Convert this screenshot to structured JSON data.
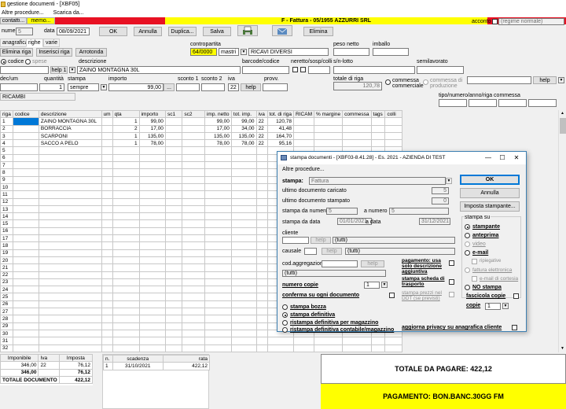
{
  "window": {
    "title": "gestione documenti - [XBF05]"
  },
  "menu": {
    "items": [
      "Altre procedure...",
      "Scarica da..."
    ]
  },
  "header": {
    "contatti_label": "contatti...",
    "memo_label": "memo...",
    "doc_title": "F - Fattura - 05/1955 AZZURRI SRL",
    "acconto_label": "acconto",
    "regime_placeholder": "(regime normale)",
    "numero_label": "numero",
    "numero_value": "5",
    "data_label": "data",
    "data_value": "08/09/2021",
    "ok_label": "OK",
    "annulla_label": "Annulla",
    "duplica_label": "Duplica...",
    "salva_label": "Salva",
    "elimina_label": "Elimina"
  },
  "tabs": [
    "anagrafica",
    "righe",
    "varie"
  ],
  "toolbar": {
    "elimina_riga": "Elimina riga",
    "inserisci_riga": "Inserisci riga",
    "arrotonda": "Arrotonda"
  },
  "row_form": {
    "contropartita_label": "contropartita",
    "contropartita_code": "64/0000",
    "contropartita_type": "mastri",
    "contropartita_desc": "RICAVI DIVERSI",
    "peso_netto_label": "peso netto",
    "imballo_label": "imballo",
    "codice_label": "codice",
    "spese_label": "spese",
    "descrizione_label": "descrizione",
    "barcode_label": "barcode/codice",
    "neretto_label": "neretto/sosp/colli",
    "sn_lotto_label": "s/n-lotto",
    "semilavorato_label": "semilavorato",
    "help1_label": "help 1",
    "descrizione_value": "ZAINO MONTAGNA 30L",
    "um_label": "dec/um",
    "quantita_label": "quantità",
    "quantita_value": "1",
    "stampa_label": "stampa",
    "stampa_value": "sempre",
    "importo_label": "importo",
    "importo_value": "99,00",
    "sconto1_label": "sconto 1",
    "sconto2_label": "sconto 2",
    "iva_label": "iva",
    "iva_value": "22",
    "help_label": "help",
    "provv_label": "provv.",
    "totale_riga_label": "totale di riga",
    "totale_riga_value": "120,78",
    "commessa_commerciale": "commessa commerciale",
    "commessa_produzione": "commessa di produzione",
    "tipo_label": "tipo/numero/anno/riga commessa",
    "ricambi_value": "RICAMBI"
  },
  "grid": {
    "columns": [
      "riga",
      "codice",
      "descrizione",
      "um",
      "qta",
      "importo",
      "sc1",
      "sc2",
      "imp. netto",
      "tot. imp.",
      "iva",
      "tot. di riga",
      "RICAM",
      "% margine",
      "commessa",
      "tags",
      "colli"
    ],
    "rows": [
      {
        "riga": "1",
        "descrizione": "ZAINO MONTAGNA 30L",
        "qta": "1",
        "importo": "99,00",
        "imp_netto": "99,00",
        "tot_imp": "99,00",
        "iva": "22",
        "tot_riga": "120,78"
      },
      {
        "riga": "2",
        "descrizione": "BORRACCIA",
        "qta": "2",
        "importo": "17,00",
        "imp_netto": "17,00",
        "tot_imp": "34,00",
        "iva": "22",
        "tot_riga": "41,48"
      },
      {
        "riga": "3",
        "descrizione": "SCARPONI",
        "qta": "1",
        "importo": "135,00",
        "imp_netto": "135,00",
        "tot_imp": "135,00",
        "iva": "22",
        "tot_riga": "164,70"
      },
      {
        "riga": "4",
        "descrizione": "SACCO A PELO",
        "qta": "1",
        "importo": "78,00",
        "imp_netto": "78,00",
        "tot_imp": "78,00",
        "iva": "22",
        "tot_riga": "95,16"
      }
    ],
    "empty_row_numbers": [
      "5",
      "6",
      "7",
      "8",
      "9",
      "10",
      "11",
      "12",
      "13",
      "14",
      "15",
      "16",
      "17",
      "18",
      "19",
      "20",
      "21",
      "22",
      "23",
      "24",
      "25",
      "26",
      "27",
      "28",
      "29",
      "30",
      "31",
      "32"
    ]
  },
  "iva_summary": {
    "columns": [
      "Imponibile",
      "Iva",
      "Imposta"
    ],
    "rows": [
      {
        "imponibile": "346,00",
        "iva": "22",
        "imposta": "76,12"
      }
    ],
    "totals": {
      "imponibile": "346,00",
      "imposta": "76,12"
    },
    "totale_documento_label": "TOTALE DOCUMENTO",
    "totale_documento_value": "422,12"
  },
  "scadenze": {
    "columns": [
      "n.",
      "scadenza",
      "rata"
    ],
    "rows": [
      {
        "n": "1",
        "scadenza": "31/10/2021",
        "rata": "422,12"
      }
    ]
  },
  "totals": {
    "totale_da_pagare": "TOTALE DA PAGARE: 422,12",
    "pagamento": "PAGAMENTO: BON.BANC.30GG FM"
  },
  "dialog": {
    "title": "stampa documenti - [XBF03-8.41.28] - Es. 2021 - AZIENDA DI TEST",
    "menu": "Altre procedure...",
    "stampa_label": "stampa:",
    "stampa_value": "Fattura",
    "ok_label": "OK",
    "annulla_label": "Annulla",
    "imposta_stampante_label": "Imposta stampante...",
    "ultimo_caricato_label": "ultimo documento caricato",
    "ultimo_caricato_value": "5",
    "ultimo_stampato_label": "ultimo documento stampato",
    "ultimo_stampato_value": "0",
    "stampa_da_numero_label": "stampa da numero",
    "stampa_da_numero_value": "5",
    "a_numero_label": "a numero",
    "a_numero_value": "5",
    "stampa_da_data_label": "stampa da data",
    "stampa_da_data_value": "01/01/2021",
    "a_data_label": "a data",
    "a_data_value": "31/12/2021",
    "cliente_label": "cliente",
    "help_label": "help",
    "tutti_value": "(tutti)",
    "causale_label": "causale",
    "cod_aggregazione_label": "cod.aggregazione",
    "numero_copie_label": "numero copie",
    "numero_copie_value": "1",
    "conferma_label": "conferma su ogni documento",
    "pagamento_usa_label": "pagamento: usa solo descrizione aggiuntiva",
    "stampa_scheda_label": "stampa scheda di trasporto",
    "stampa_prezzi_label": "stampa prezzi nel DDT (se previsti)",
    "fascicola_label": "fascicola copie",
    "copie_label": "copie",
    "copie_value": "1",
    "aggiorna_privacy_label": "aggiorna privacy su anagrafica cliente",
    "stampa_su_label": "stampa su",
    "stampa_su_options": [
      "stampante",
      "anteprima",
      "video",
      "e-mail",
      "ripiegative",
      "fattura elettronica",
      "e-mail di cortesia",
      "NO stampa"
    ],
    "modalita_options": [
      "stampa bozza",
      "stampa definitiva",
      "ristampa definitiva per magazzino",
      "ristampa definitiva contabile/magazzino"
    ]
  }
}
